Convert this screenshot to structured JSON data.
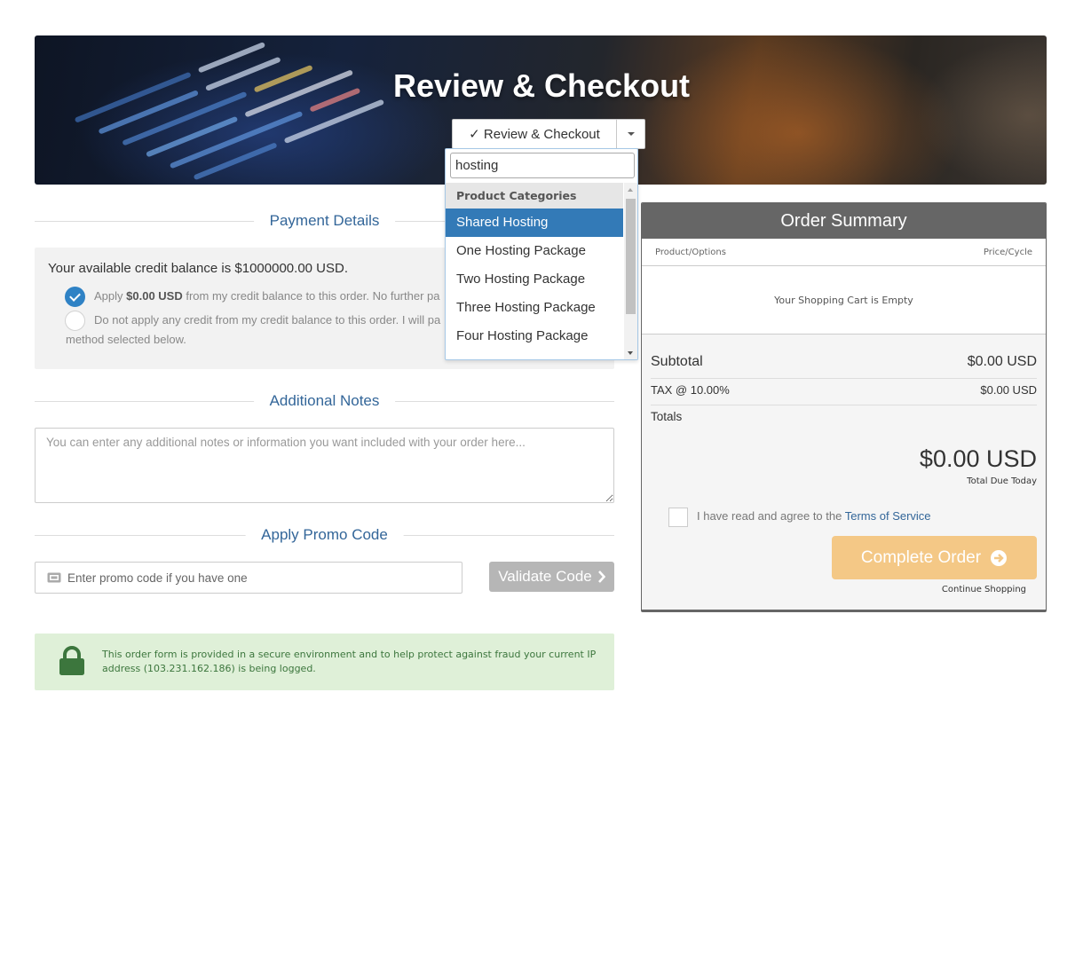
{
  "hero": {
    "title": "Review & Checkout",
    "step_button_label": "✓ Review & Checkout"
  },
  "dropdown": {
    "search_value": "hosting",
    "group_label": "Product Categories",
    "items": [
      {
        "label": "Shared Hosting",
        "selected": true
      },
      {
        "label": "One Hosting Package",
        "selected": false
      },
      {
        "label": "Two Hosting Package",
        "selected": false
      },
      {
        "label": "Three Hosting Package",
        "selected": false
      },
      {
        "label": "Four Hosting Package",
        "selected": false
      }
    ]
  },
  "payment": {
    "heading": "Payment Details",
    "balance_text": "Your available credit balance is $1000000.00 USD.",
    "option_apply_prefix": "Apply ",
    "option_apply_amount": "$0.00 USD",
    "option_apply_suffix": " from my credit balance to this order. No further pa",
    "option_none_line1": "Do not apply any credit from my credit balance to this order. I will pa",
    "option_none_line2": "method selected below."
  },
  "notes": {
    "heading": "Additional Notes",
    "placeholder": "You can enter any additional notes or information you want included with your order here..."
  },
  "promo": {
    "heading": "Apply Promo Code",
    "placeholder": "Enter promo code if you have one",
    "validate_label": "Validate Code"
  },
  "security": {
    "message": "This order form is provided in a secure environment and to help protect against fraud your current IP address (103.231.162.186) is being logged."
  },
  "summary": {
    "title": "Order Summary",
    "col_product": "Product/Options",
    "col_price": "Price/Cycle",
    "empty_text": "Your Shopping Cart is Empty",
    "subtotal_label": "Subtotal",
    "subtotal_value": "$0.00 USD",
    "tax_label": "TAX @ 10.00%",
    "tax_value": "$0.00 USD",
    "totals_label": "Totals",
    "total_value": "$0.00 USD",
    "total_caption": "Total Due Today",
    "tos_prefix": "I have read and agree to the ",
    "tos_link": "Terms of Service",
    "complete_label": "Complete Order",
    "continue_label": "Continue Shopping"
  },
  "colors": {
    "accent_blue": "#337ab7",
    "heading_blue": "#336699",
    "complete_button": "#f4c886",
    "security_bg": "#dff0d8",
    "security_text": "#3c763d"
  }
}
